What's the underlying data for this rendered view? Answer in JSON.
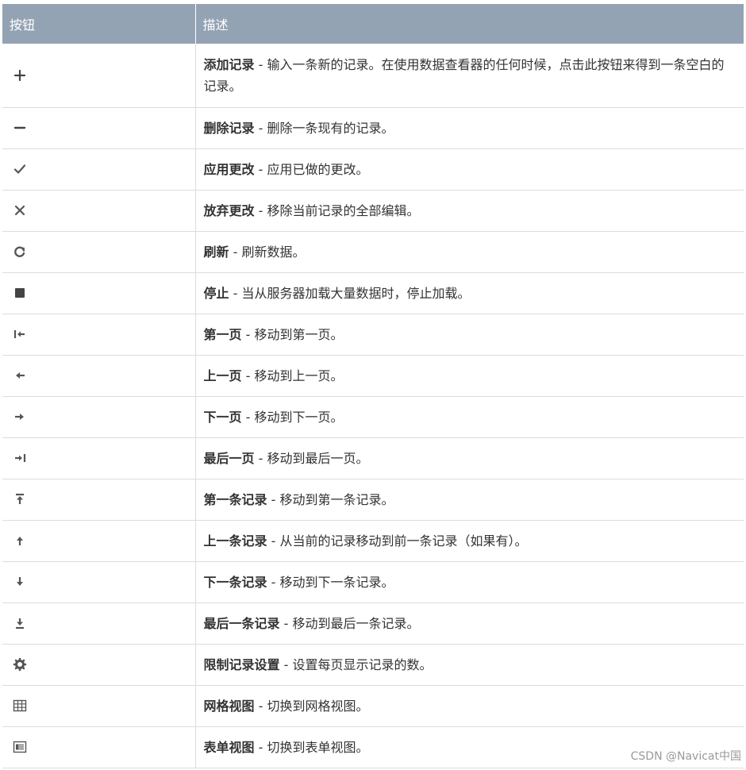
{
  "table": {
    "headers": {
      "button": "按钮",
      "description": "描述"
    },
    "rows": [
      {
        "icon": "plus-icon",
        "name": "添加记录",
        "desc": "输入一条新的记录。在使用数据查看器的任何时候，点击此按钮来得到一条空白的记录。"
      },
      {
        "icon": "minus-icon",
        "name": "删除记录",
        "desc": "删除一条现有的记录。"
      },
      {
        "icon": "check-icon",
        "name": "应用更改",
        "desc": "应用已做的更改。"
      },
      {
        "icon": "close-icon",
        "name": "放弃更改",
        "desc": "移除当前记录的全部编辑。"
      },
      {
        "icon": "refresh-icon",
        "name": "刷新",
        "desc": "刷新数据。"
      },
      {
        "icon": "stop-icon",
        "name": "停止",
        "desc": "当从服务器加载大量数据时，停止加载。"
      },
      {
        "icon": "first-page-icon",
        "name": "第一页",
        "desc": "移动到第一页。"
      },
      {
        "icon": "previous-page-icon",
        "name": "上一页",
        "desc": "移动到上一页。"
      },
      {
        "icon": "next-page-icon",
        "name": "下一页",
        "desc": "移动到下一页。"
      },
      {
        "icon": "last-page-icon",
        "name": "最后一页",
        "desc": "移动到最后一页。"
      },
      {
        "icon": "first-record-icon",
        "name": "第一条记录",
        "desc": "移动到第一条记录。"
      },
      {
        "icon": "previous-record-icon",
        "name": "上一条记录",
        "desc": "从当前的记录移动到前一条记录（如果有）。"
      },
      {
        "icon": "next-record-icon",
        "name": "下一条记录",
        "desc": "移动到下一条记录。"
      },
      {
        "icon": "last-record-icon",
        "name": "最后一条记录",
        "desc": "移动到最后一条记录。"
      },
      {
        "icon": "gear-icon",
        "name": "限制记录设置",
        "desc": "设置每页显示记录的数。"
      },
      {
        "icon": "grid-view-icon",
        "name": "网格视图",
        "desc": "切换到网格视图。"
      },
      {
        "icon": "form-view-icon",
        "name": "表单视图",
        "desc": "切换到表单视图。"
      }
    ]
  },
  "separator": " - ",
  "watermark": "CSDN @Navicat中国"
}
